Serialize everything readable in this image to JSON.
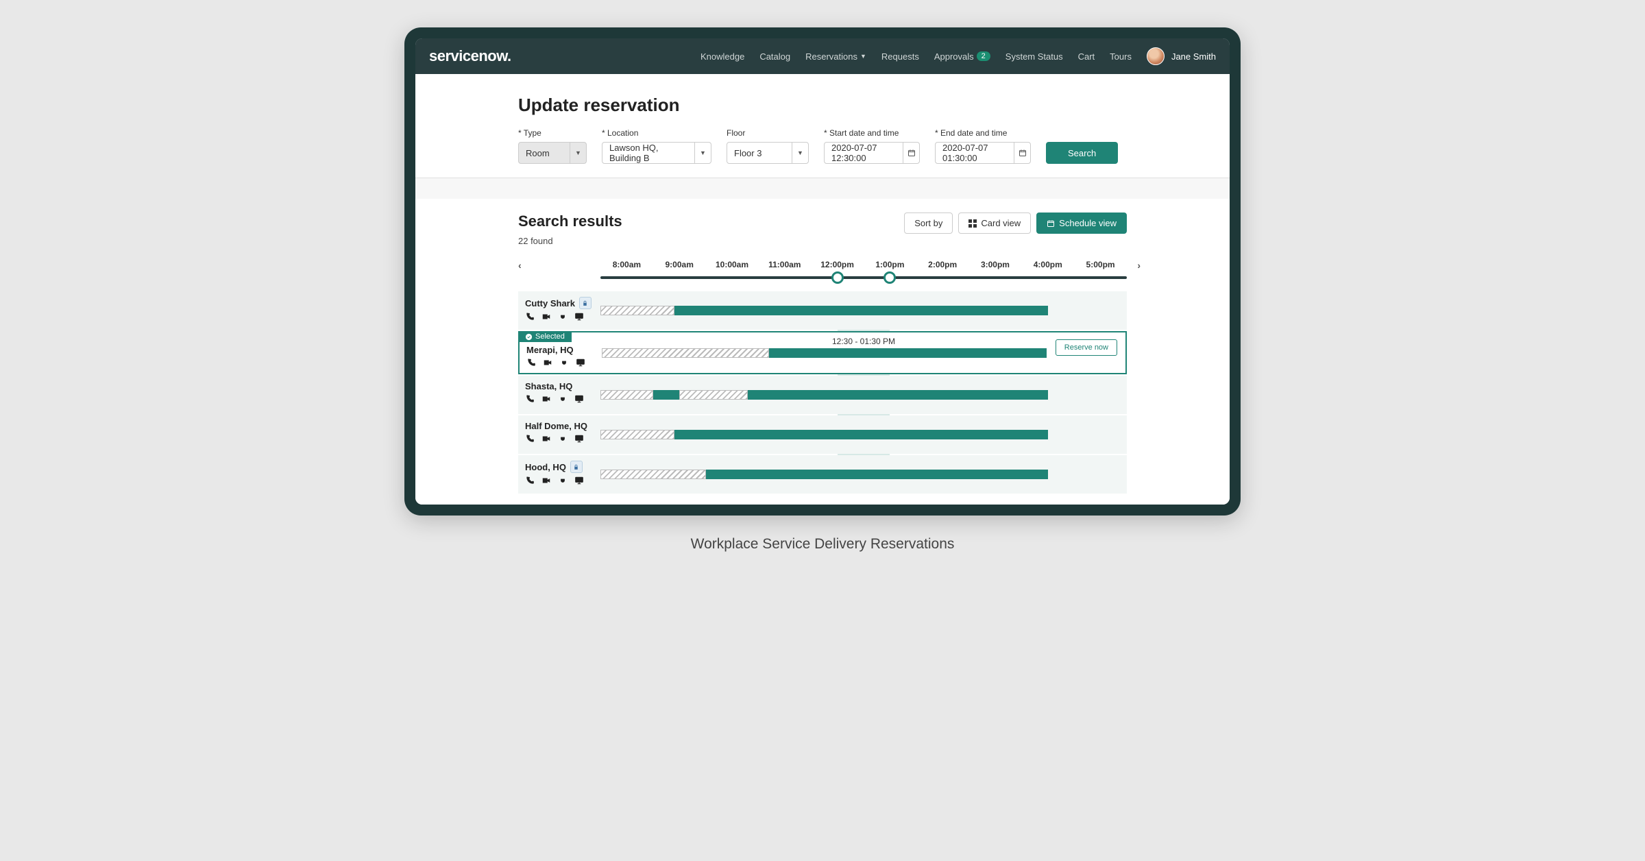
{
  "brand": "servicenow.",
  "nav": {
    "knowledge": "Knowledge",
    "catalog": "Catalog",
    "reservations": "Reservations",
    "requests": "Requests",
    "approvals": "Approvals",
    "approvals_count": "2",
    "system_status": "System Status",
    "cart": "Cart",
    "tours": "Tours",
    "username": "Jane Smith"
  },
  "page_title": "Update reservation",
  "form": {
    "type_label": "* Type",
    "type_value": "Room",
    "location_label": "* Location",
    "location_value": "Lawson HQ, Building B",
    "floor_label": "Floor",
    "floor_value": "Floor 3",
    "start_label": "* Start date and time",
    "start_value": "2020-07-07  12:30:00",
    "end_label": "* End date and time",
    "end_value": "2020-07-07  01:30:00",
    "search_btn": "Search"
  },
  "results": {
    "title": "Search results",
    "count": "22 found",
    "sort_by": "Sort by",
    "card_view": "Card view",
    "schedule_view": "Schedule view"
  },
  "timeline": {
    "labels": [
      "8:00am",
      "9:00am",
      "10:00am",
      "11:00am",
      "12:00pm",
      "1:00pm",
      "2:00pm",
      "3:00pm",
      "4:00pm",
      "5:00pm"
    ],
    "handle_start_pct": 45,
    "handle_end_pct": 55,
    "selection_start_pct": 45,
    "selection_end_pct": 55
  },
  "rooms": [
    {
      "name": "Cutty Shark",
      "locked": true,
      "selected": false,
      "bars": [
        {
          "start": 0,
          "end": 14,
          "hatched": true
        },
        {
          "start": 14,
          "end": 85,
          "hatched": false
        }
      ]
    },
    {
      "name": "Merapi, HQ",
      "locked": false,
      "selected": true,
      "time_text": "12:30 - 01:30 PM",
      "reserve_label": "Reserve now",
      "selected_label": "Selected",
      "bars": [
        {
          "start": 0,
          "end": 32,
          "hatched": true
        },
        {
          "start": 32,
          "end": 85,
          "hatched": false
        }
      ]
    },
    {
      "name": "Shasta, HQ",
      "locked": false,
      "selected": false,
      "bars": [
        {
          "start": 0,
          "end": 10,
          "hatched": true
        },
        {
          "start": 10,
          "end": 15,
          "hatched": false
        },
        {
          "start": 15,
          "end": 28,
          "hatched": true
        },
        {
          "start": 28,
          "end": 85,
          "hatched": false
        }
      ]
    },
    {
      "name": "Half Dome, HQ",
      "locked": false,
      "selected": false,
      "bars": [
        {
          "start": 0,
          "end": 14,
          "hatched": true
        },
        {
          "start": 14,
          "end": 85,
          "hatched": false
        }
      ]
    },
    {
      "name": "Hood, HQ",
      "locked": true,
      "selected": false,
      "bars": [
        {
          "start": 0,
          "end": 20,
          "hatched": true
        },
        {
          "start": 20,
          "end": 85,
          "hatched": false
        }
      ]
    }
  ],
  "caption": "Workplace Service Delivery Reservations"
}
